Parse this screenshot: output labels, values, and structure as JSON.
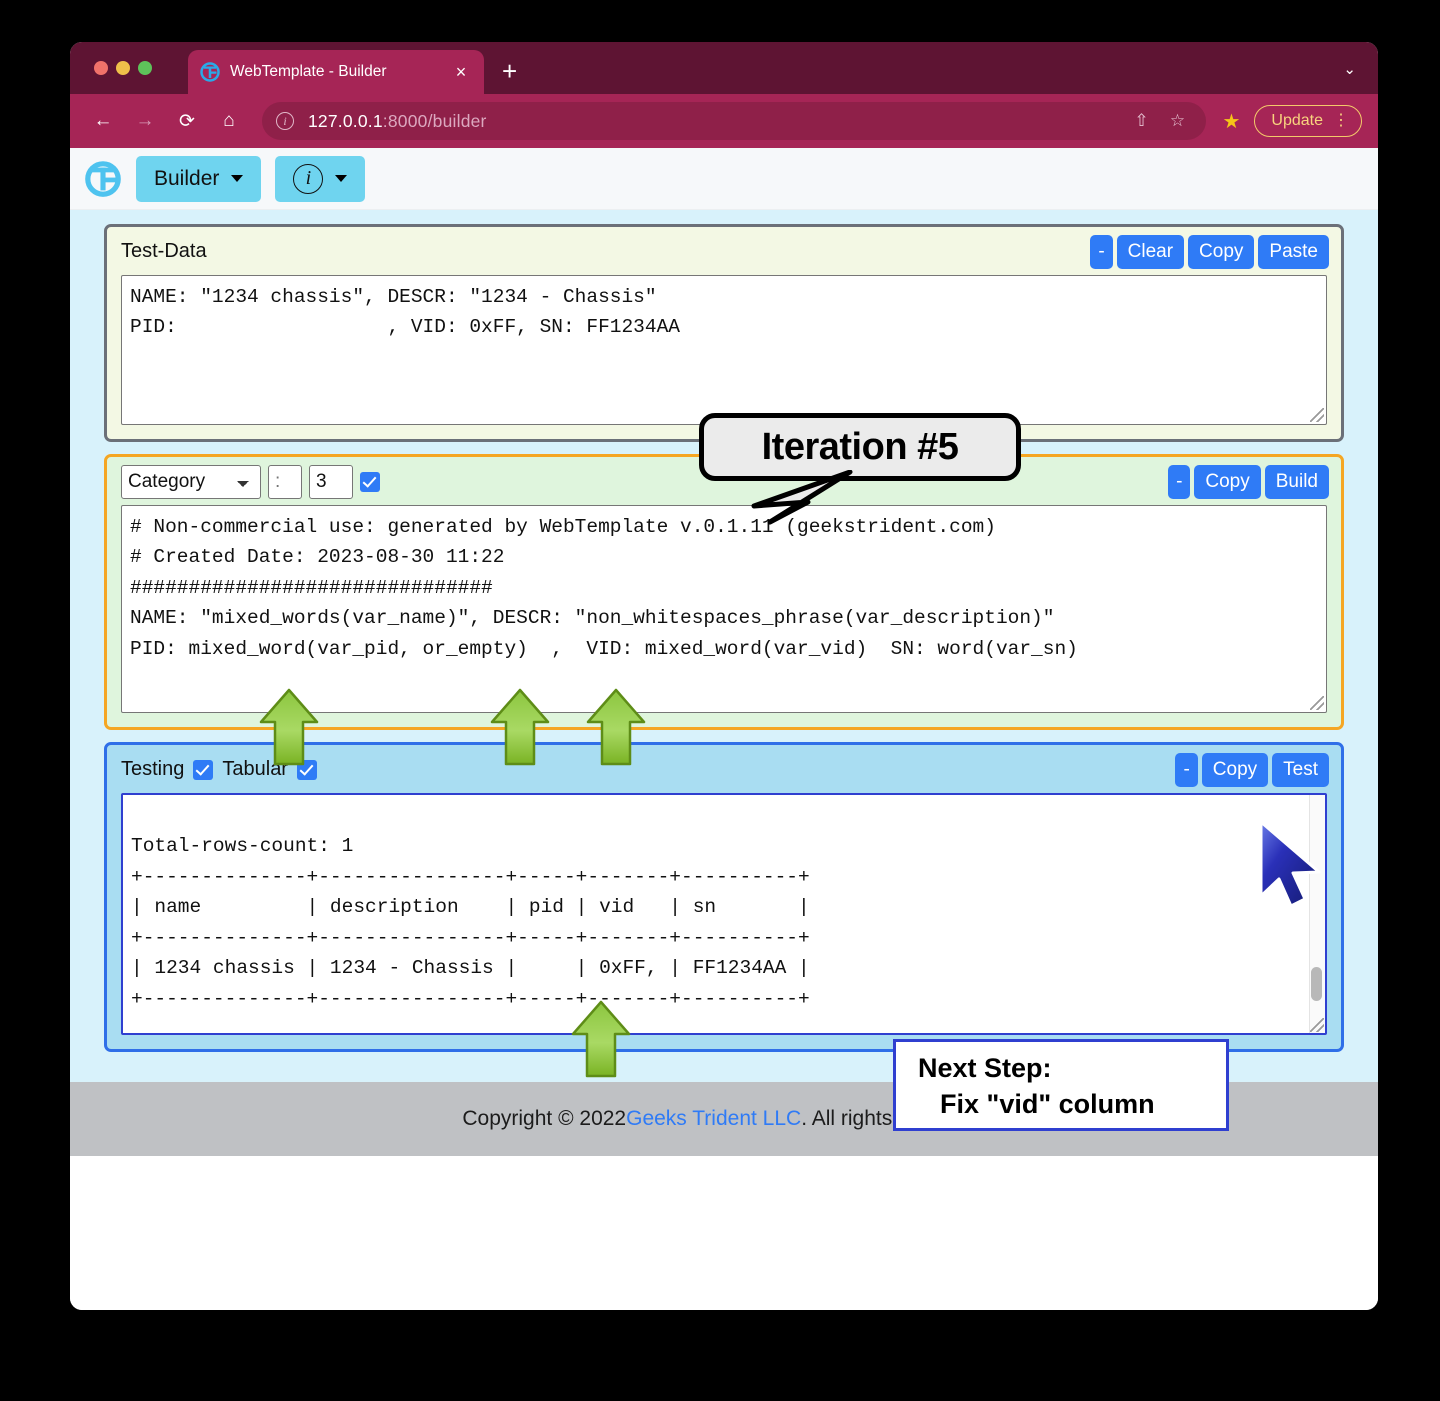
{
  "browser": {
    "tab": {
      "title": "WebTemplate - Builder",
      "favicon": "webtemplate-logo-icon",
      "close": "×"
    },
    "new_tab": "+",
    "tab_list_chevron": "⌄",
    "nav": {
      "back": "←",
      "forward": "→",
      "reload": "⟳",
      "home": "⌂"
    },
    "omnibox": {
      "info_icon": "i",
      "url_host": "127.0.0.1",
      "url_path": ":8000/builder",
      "share_icon": "⇧",
      "bookmark_icon": "☆"
    },
    "star_filled": "★",
    "update": {
      "label": "Update",
      "kebab": "⋮"
    }
  },
  "app": {
    "navbar": {
      "logo": "geeks-trident-logo",
      "builder_label": "Builder",
      "info_label": "i"
    },
    "test_data": {
      "title": "Test-Data",
      "buttons": [
        "-",
        "Clear",
        "Copy",
        "Paste"
      ],
      "content": "NAME: \"1234 chassis\", DESCR: \"1234 - Chassis\"\nPID:                  , VID: 0xFF, SN: FF1234AA"
    },
    "template": {
      "category_selected": "Category",
      "category_options": [
        "Category"
      ],
      "separator_value": "",
      "separator_placeholder": ":",
      "count_value": "3",
      "checkbox_checked": true,
      "buttons": [
        "-",
        "Copy",
        "Build"
      ],
      "content": "# Non-commercial use: generated by WebTemplate v.0.1.11 (geekstrident.com)\n# Created Date: 2023-08-30 11:22\n###############################\nNAME: \"mixed_words(var_name)\", DESCR: \"non_whitespaces_phrase(var_description)\"\nPID: mixed_word(var_pid, or_empty)  ,  VID: mixed_word(var_vid)  SN: word(var_sn)"
    },
    "testing": {
      "title": "Testing",
      "testing_checked": true,
      "tabular_label": "Tabular",
      "tabular_checked": true,
      "buttons": [
        "-",
        "Copy",
        "Test"
      ],
      "content": "\nTotal-rows-count: 1\n+--------------+----------------+-----+-------+----------+\n| name         | description    | pid | vid   | sn       |\n+--------------+----------------+-----+-------+----------+\n| 1234 chassis | 1234 - Chassis |     | 0xFF, | FF1234AA |\n+--------------+----------------+-----+-------+----------+"
    },
    "footer": {
      "prefix": "Copyright © 2022 ",
      "link": "Geeks Trident LLC",
      "suffix": ". All rights reserved."
    }
  },
  "annotations": {
    "bubble_text": "Iteration #5",
    "next_step_line1": "Next Step:",
    "next_step_line2": "Fix \"vid\" column",
    "arrow_color": "#8cc63f",
    "cursor_color": "#1a1ab0"
  },
  "colors": {
    "browser_chrome": "#a62556",
    "browser_tabstrip": "#5e1433",
    "accent_button": "#2f7bf6",
    "nav_pill": "#6fd4ef",
    "content_bg": "#d8f2fb",
    "testdata_bg": "#f3f8e4",
    "template_bg": "#dff5dd",
    "template_border": "#f5a623",
    "testing_bg": "#a9ddf2",
    "testing_border": "#2f6fe8",
    "footer_bg": "#bfc1c4",
    "update_pill": "#f8d37e"
  }
}
